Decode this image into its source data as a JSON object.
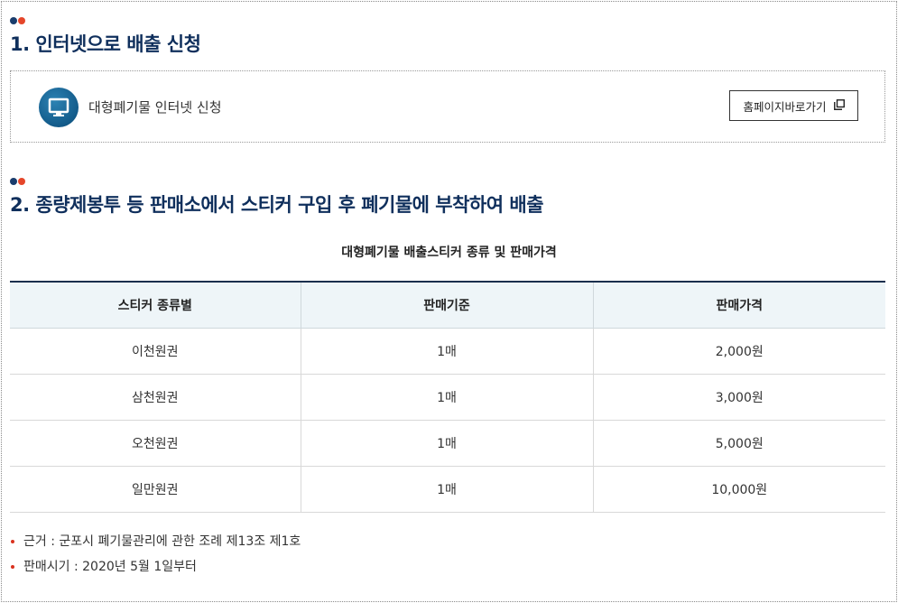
{
  "colors": {
    "title": "#0f2f5c",
    "dot_navy": "#1a3d6d",
    "dot_red": "#e5462a",
    "icon_blue": "#135b8a",
    "bullet_red": "#d9321f"
  },
  "section1": {
    "title": "1. 인터넷으로 배출 신청",
    "apply_label": "대형폐기물 인터넷 신청",
    "icon": "monitor-icon",
    "home_button_label": "홈페이지바로가기",
    "home_button_icon": "new-window-icon"
  },
  "section2": {
    "title": "2. 종량제봉투 등 판매소에서 스티커 구입 후 폐기물에 부착하여 배출",
    "table_caption": "대형폐기물 배출스티커 종류 및 판매가격",
    "table": {
      "headers": [
        "스티커 종류별",
        "판매기준",
        "판매가격"
      ],
      "rows": [
        [
          "이천원권",
          "1매",
          "2,000원"
        ],
        [
          "삼천원권",
          "1매",
          "3,000원"
        ],
        [
          "오천원권",
          "1매",
          "5,000원"
        ],
        [
          "일만원권",
          "1매",
          "10,000원"
        ]
      ]
    },
    "notes": [
      "근거 : 군포시 폐기물관리에 관한 조례 제13조 제1호",
      "판매시기 : 2020년 5월 1일부터"
    ]
  }
}
